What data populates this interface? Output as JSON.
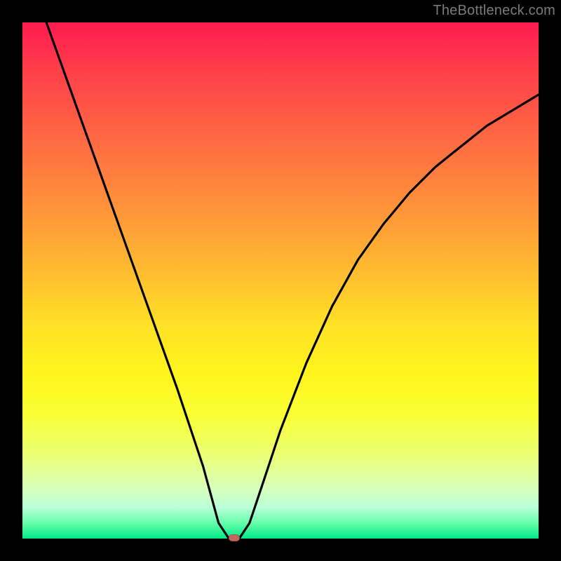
{
  "watermark": "TheBottleneck.com",
  "chart_data": {
    "type": "line",
    "title": "",
    "xlabel": "",
    "ylabel": "",
    "xlim": [
      0,
      100
    ],
    "ylim": [
      0,
      100
    ],
    "series": [
      {
        "name": "curve",
        "x": [
          0,
          5,
          10,
          15,
          20,
          25,
          30,
          35,
          38,
          40,
          41,
          42,
          44,
          46,
          50,
          55,
          60,
          65,
          70,
          75,
          80,
          85,
          90,
          95,
          100
        ],
        "y": [
          113,
          99,
          85,
          71,
          57,
          43,
          29,
          14,
          3,
          0,
          0,
          0,
          3,
          9,
          21,
          34,
          45,
          54,
          61,
          67,
          72,
          76,
          80,
          83,
          86
        ]
      }
    ],
    "annotations": [
      {
        "name": "marker",
        "x": 41,
        "y": 0
      }
    ]
  }
}
